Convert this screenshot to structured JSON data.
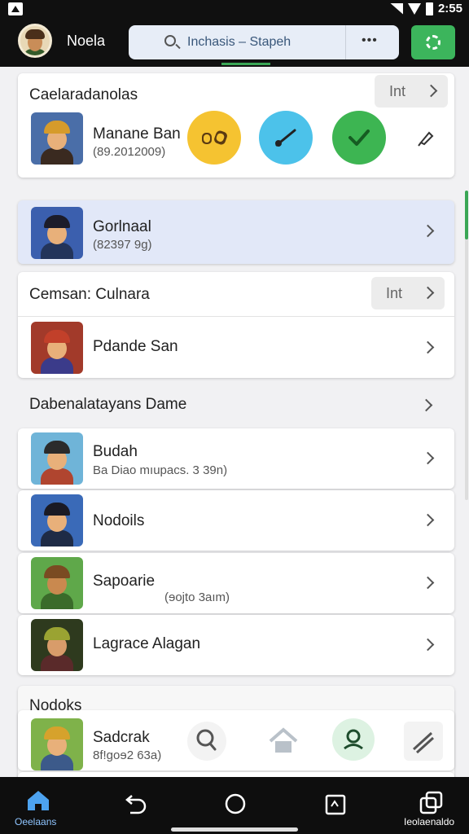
{
  "status_bar": {
    "time": "2:55"
  },
  "app_bar": {
    "title": "Noela",
    "search_value": "Inchasis – Stapeh",
    "more_glyph": "•••",
    "icons": {
      "search": "search-icon",
      "settings": "settings-gear-icon"
    }
  },
  "sections": {
    "s1": {
      "title": "Caelaradanolas",
      "pill_label": "Int",
      "item": {
        "name": "Manane Ban",
        "sub": "(89.2012009)"
      },
      "actions": [
        {
          "icon": "binoculars-icon",
          "color": "#f5c331"
        },
        {
          "icon": "wand-icon",
          "color": "#4cc2ea"
        },
        {
          "icon": "check-icon",
          "color": "#3db552"
        },
        {
          "icon": "pin-icon",
          "color": "#ffffff"
        }
      ]
    },
    "s2": {
      "item": {
        "name": "Gorlnaal",
        "sub": "(82397 9g)"
      }
    },
    "s3": {
      "title": "Cemsan: Culnara",
      "pill_label": "Int",
      "item": {
        "name": "Pdande San"
      }
    },
    "s4": {
      "title": "Dabenalatayans Dame",
      "items": [
        {
          "name": "Budah",
          "sub": "Ba Diao mıupacs. 3 39n)"
        },
        {
          "name": "Nodoils"
        },
        {
          "name": "Sapoarie",
          "sub": "(ɘojto 3aım)"
        },
        {
          "name": "Lagrace Alagan"
        }
      ]
    },
    "s5": {
      "title": "Nodoks",
      "item": {
        "name": "Sadcrak",
        "sub": "8f!ɡoɘ2 63a)"
      },
      "actions": [
        "search-icon",
        "home-icon",
        "profile-icon",
        "send-icon"
      ]
    }
  },
  "bottom_nav": {
    "left_label": "Oeelaans",
    "right_label": "Ieolaenaldo",
    "icons": [
      "home-icon",
      "back-icon",
      "circle-home-icon",
      "recents-icon",
      "copy-icon"
    ]
  },
  "colors": {
    "accent": "#3aa655",
    "selected_row": "#e2e8f8"
  }
}
